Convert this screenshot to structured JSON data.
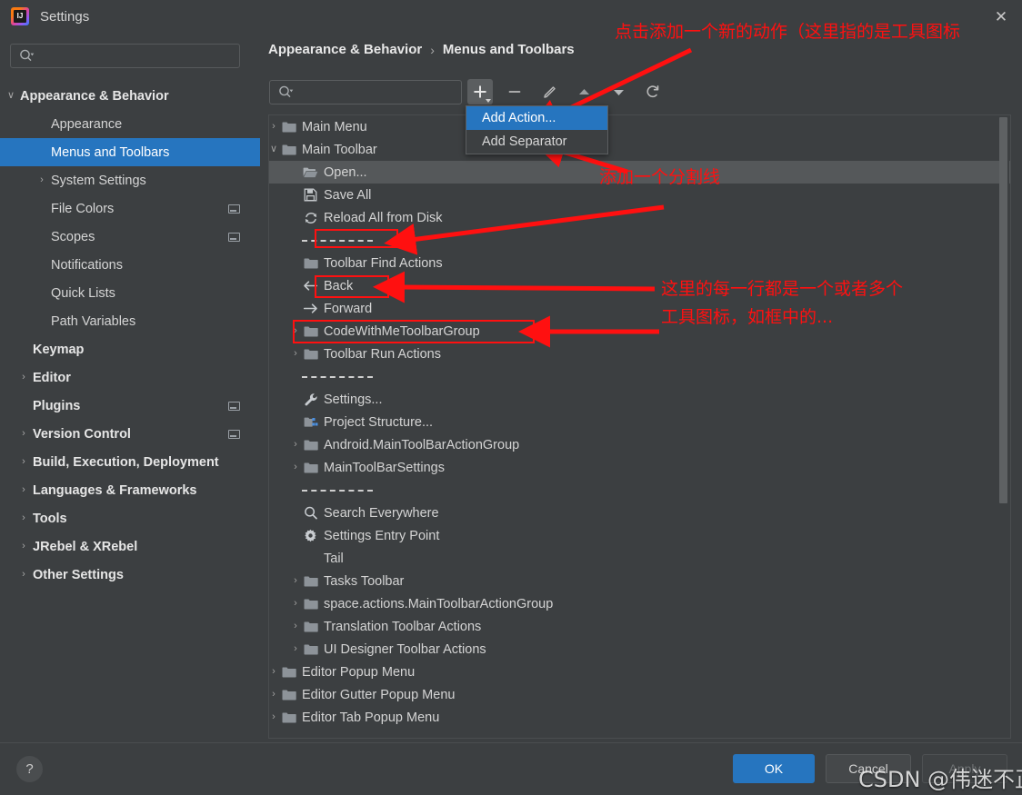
{
  "window": {
    "title": "Settings",
    "app_icon": "intellij-idea-icon",
    "close_icon": "close-icon"
  },
  "sidebar": {
    "search": {
      "placeholder": "",
      "value": "",
      "icon": "search-icon"
    },
    "items": [
      {
        "label": "Appearance & Behavior",
        "indent": 22,
        "arrow": "∨",
        "bold": true,
        "selected": false,
        "badge": false
      },
      {
        "label": "Appearance",
        "indent": 56,
        "arrow": "",
        "bold": false,
        "selected": false,
        "badge": false
      },
      {
        "label": "Menus and Toolbars",
        "indent": 56,
        "arrow": "",
        "bold": false,
        "selected": true,
        "badge": false
      },
      {
        "label": "System Settings",
        "indent": 56,
        "arrow": "›",
        "bold": false,
        "selected": false,
        "badge": false
      },
      {
        "label": "File Colors",
        "indent": 56,
        "arrow": "",
        "bold": false,
        "selected": false,
        "badge": true
      },
      {
        "label": "Scopes",
        "indent": 56,
        "arrow": "",
        "bold": false,
        "selected": false,
        "badge": true
      },
      {
        "label": "Notifications",
        "indent": 56,
        "arrow": "",
        "bold": false,
        "selected": false,
        "badge": false
      },
      {
        "label": "Quick Lists",
        "indent": 56,
        "arrow": "",
        "bold": false,
        "selected": false,
        "badge": false
      },
      {
        "label": "Path Variables",
        "indent": 56,
        "arrow": "",
        "bold": false,
        "selected": false,
        "badge": false
      },
      {
        "label": "Keymap",
        "indent": 36,
        "arrow": "",
        "bold": true,
        "selected": false,
        "badge": false
      },
      {
        "label": "Editor",
        "indent": 36,
        "arrow": "›",
        "bold": true,
        "selected": false,
        "badge": false
      },
      {
        "label": "Plugins",
        "indent": 36,
        "arrow": "",
        "bold": true,
        "selected": false,
        "badge": true
      },
      {
        "label": "Version Control",
        "indent": 36,
        "arrow": "›",
        "bold": true,
        "selected": false,
        "badge": true
      },
      {
        "label": "Build, Execution, Deployment",
        "indent": 36,
        "arrow": "›",
        "bold": true,
        "selected": false,
        "badge": false
      },
      {
        "label": "Languages & Frameworks",
        "indent": 36,
        "arrow": "›",
        "bold": true,
        "selected": false,
        "badge": false
      },
      {
        "label": "Tools",
        "indent": 36,
        "arrow": "›",
        "bold": true,
        "selected": false,
        "badge": false
      },
      {
        "label": "JRebel & XRebel",
        "indent": 36,
        "arrow": "›",
        "bold": true,
        "selected": false,
        "badge": false
      },
      {
        "label": "Other Settings",
        "indent": 36,
        "arrow": "›",
        "bold": true,
        "selected": false,
        "badge": false
      }
    ]
  },
  "content": {
    "breadcrumb": {
      "parent": "Appearance & Behavior",
      "separator": "›",
      "current": "Menus and Toolbars"
    },
    "search": {
      "placeholder": "",
      "value": "",
      "icon": "search-icon"
    },
    "toolbar": [
      {
        "name": "add-button",
        "icon": "plus-icon",
        "active": true,
        "has_caret": true
      },
      {
        "name": "remove-button",
        "icon": "minus-icon",
        "active": false,
        "has_caret": false
      },
      {
        "name": "edit-button",
        "icon": "pencil-icon",
        "active": false,
        "has_caret": false
      },
      {
        "name": "move-up-button",
        "icon": "triangle-up-icon",
        "active": false,
        "has_caret": false
      },
      {
        "name": "move-down-button",
        "icon": "triangle-down-icon",
        "active": false,
        "has_caret": false
      },
      {
        "name": "restore-button",
        "icon": "revert-icon",
        "active": false,
        "has_caret": false
      }
    ],
    "add_menu": {
      "open": true,
      "items": [
        {
          "label": "Add Action...",
          "highlighted": true
        },
        {
          "label": "Add Separator",
          "highlighted": false
        }
      ]
    },
    "tree": [
      {
        "label": "Main Menu",
        "indent": 12,
        "arrow": "›",
        "icon": "folder-icon",
        "selected": false,
        "separator": false
      },
      {
        "label": "Main Toolbar",
        "indent": 12,
        "arrow": "∨",
        "icon": "folder-icon",
        "selected": false,
        "separator": false
      },
      {
        "label": "Open...",
        "indent": 36,
        "arrow": "",
        "icon": "open-folder-icon",
        "selected": true,
        "separator": false
      },
      {
        "label": "Save All",
        "indent": 36,
        "arrow": "",
        "icon": "save-icon",
        "selected": false,
        "separator": false
      },
      {
        "label": "Reload All from Disk",
        "indent": 36,
        "arrow": "",
        "icon": "reload-icon",
        "selected": false,
        "separator": false
      },
      {
        "label": "",
        "indent": 36,
        "arrow": "",
        "icon": "",
        "selected": false,
        "separator": true
      },
      {
        "label": "Toolbar Find Actions",
        "indent": 36,
        "arrow": "",
        "icon": "folder-icon",
        "selected": false,
        "separator": false
      },
      {
        "label": "Back",
        "indent": 36,
        "arrow": "",
        "icon": "arrow-left-icon",
        "selected": false,
        "separator": false
      },
      {
        "label": "Forward",
        "indent": 36,
        "arrow": "",
        "icon": "arrow-right-icon",
        "selected": false,
        "separator": false
      },
      {
        "label": "CodeWithMeToolbarGroup",
        "indent": 36,
        "arrow": "›",
        "icon": "folder-icon",
        "selected": false,
        "separator": false
      },
      {
        "label": "Toolbar Run Actions",
        "indent": 36,
        "arrow": "›",
        "icon": "folder-icon",
        "selected": false,
        "separator": false
      },
      {
        "label": "",
        "indent": 36,
        "arrow": "",
        "icon": "",
        "selected": false,
        "separator": true
      },
      {
        "label": "Settings...",
        "indent": 36,
        "arrow": "",
        "icon": "wrench-icon",
        "selected": false,
        "separator": false
      },
      {
        "label": "Project Structure...",
        "indent": 36,
        "arrow": "",
        "icon": "project-structure-icon",
        "selected": false,
        "separator": false
      },
      {
        "label": "Android.MainToolBarActionGroup",
        "indent": 36,
        "arrow": "›",
        "icon": "folder-icon",
        "selected": false,
        "separator": false
      },
      {
        "label": "MainToolBarSettings",
        "indent": 36,
        "arrow": "›",
        "icon": "folder-icon",
        "selected": false,
        "separator": false
      },
      {
        "label": "",
        "indent": 36,
        "arrow": "",
        "icon": "",
        "selected": false,
        "separator": true
      },
      {
        "label": "Search Everywhere",
        "indent": 36,
        "arrow": "",
        "icon": "search-icon",
        "selected": false,
        "separator": false
      },
      {
        "label": "Settings Entry Point",
        "indent": 36,
        "arrow": "",
        "icon": "gear-icon",
        "selected": false,
        "separator": false
      },
      {
        "label": "Tail",
        "indent": 36,
        "arrow": "",
        "icon": "",
        "selected": false,
        "separator": false
      },
      {
        "label": "Tasks Toolbar",
        "indent": 36,
        "arrow": "›",
        "icon": "folder-icon",
        "selected": false,
        "separator": false
      },
      {
        "label": "space.actions.MainToolbarActionGroup",
        "indent": 36,
        "arrow": "›",
        "icon": "folder-icon",
        "selected": false,
        "separator": false
      },
      {
        "label": "Translation Toolbar Actions",
        "indent": 36,
        "arrow": "›",
        "icon": "folder-icon",
        "selected": false,
        "separator": false
      },
      {
        "label": "UI Designer Toolbar Actions",
        "indent": 36,
        "arrow": "›",
        "icon": "folder-icon",
        "selected": false,
        "separator": false
      },
      {
        "label": "Editor Popup Menu",
        "indent": 12,
        "arrow": "›",
        "icon": "folder-icon",
        "selected": false,
        "separator": false
      },
      {
        "label": "Editor Gutter Popup Menu",
        "indent": 12,
        "arrow": "›",
        "icon": "folder-icon",
        "selected": false,
        "separator": false
      },
      {
        "label": "Editor Tab Popup Menu",
        "indent": 12,
        "arrow": "›",
        "icon": "folder-icon",
        "selected": false,
        "separator": false
      }
    ]
  },
  "annotations": {
    "color": "#ff1010",
    "texts": [
      {
        "id": "anno-add-action",
        "text": "点击添加一个新的动作（这里指的是工具图标"
      },
      {
        "id": "anno-separator",
        "text": "添加一个分割线"
      },
      {
        "id": "anno-rows-line1",
        "text": "这里的每一行都是一个或者多个"
      },
      {
        "id": "anno-rows-line2",
        "text": "工具图标，如框中的..."
      }
    ]
  },
  "footer": {
    "help_label": "?",
    "ok_label": "OK",
    "cancel_label": "Cancel",
    "apply_label": "Apply"
  },
  "watermark": {
    "text": "CSDN @伟迷不正"
  }
}
